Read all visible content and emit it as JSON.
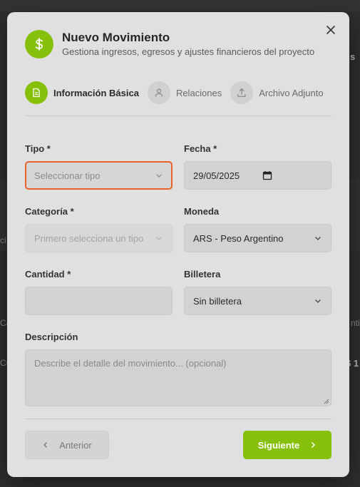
{
  "background": {
    "fragments": [
      "s",
      "ci",
      "Ca",
      "Cu",
      "nti",
      "$ 1"
    ]
  },
  "modal": {
    "title": "Nuevo Movimiento",
    "subtitle": "Gestiona ingresos, egresos y ajustes financieros del proyecto",
    "icon": "dollar-sign-icon",
    "accent_color": "#86c00a",
    "focus_color": "#e8622c"
  },
  "steps": [
    {
      "label": "Información Básica",
      "icon": "document-icon",
      "active": true
    },
    {
      "label": "Relaciones",
      "icon": "user-icon",
      "active": false
    },
    {
      "label": "Archivo Adjunto",
      "icon": "upload-icon",
      "active": false
    }
  ],
  "form": {
    "tipo": {
      "label": "Tipo *",
      "placeholder": "Seleccionar tipo",
      "value": ""
    },
    "fecha": {
      "label": "Fecha *",
      "value": "29/05/2025"
    },
    "categoria": {
      "label": "Categoría *",
      "placeholder": "Primero selecciona un tipo",
      "disabled": true
    },
    "moneda": {
      "label": "Moneda",
      "value": "ARS - Peso Argentino"
    },
    "cantidad": {
      "label": "Cantidad *",
      "value": ""
    },
    "billetera": {
      "label": "Billetera",
      "value": "Sin billetera"
    },
    "descripcion": {
      "label": "Descripción",
      "placeholder": "Describe el detalle del movimiento... (opcional)"
    }
  },
  "footer": {
    "prev_label": "Anterior",
    "next_label": "Siguiente"
  }
}
